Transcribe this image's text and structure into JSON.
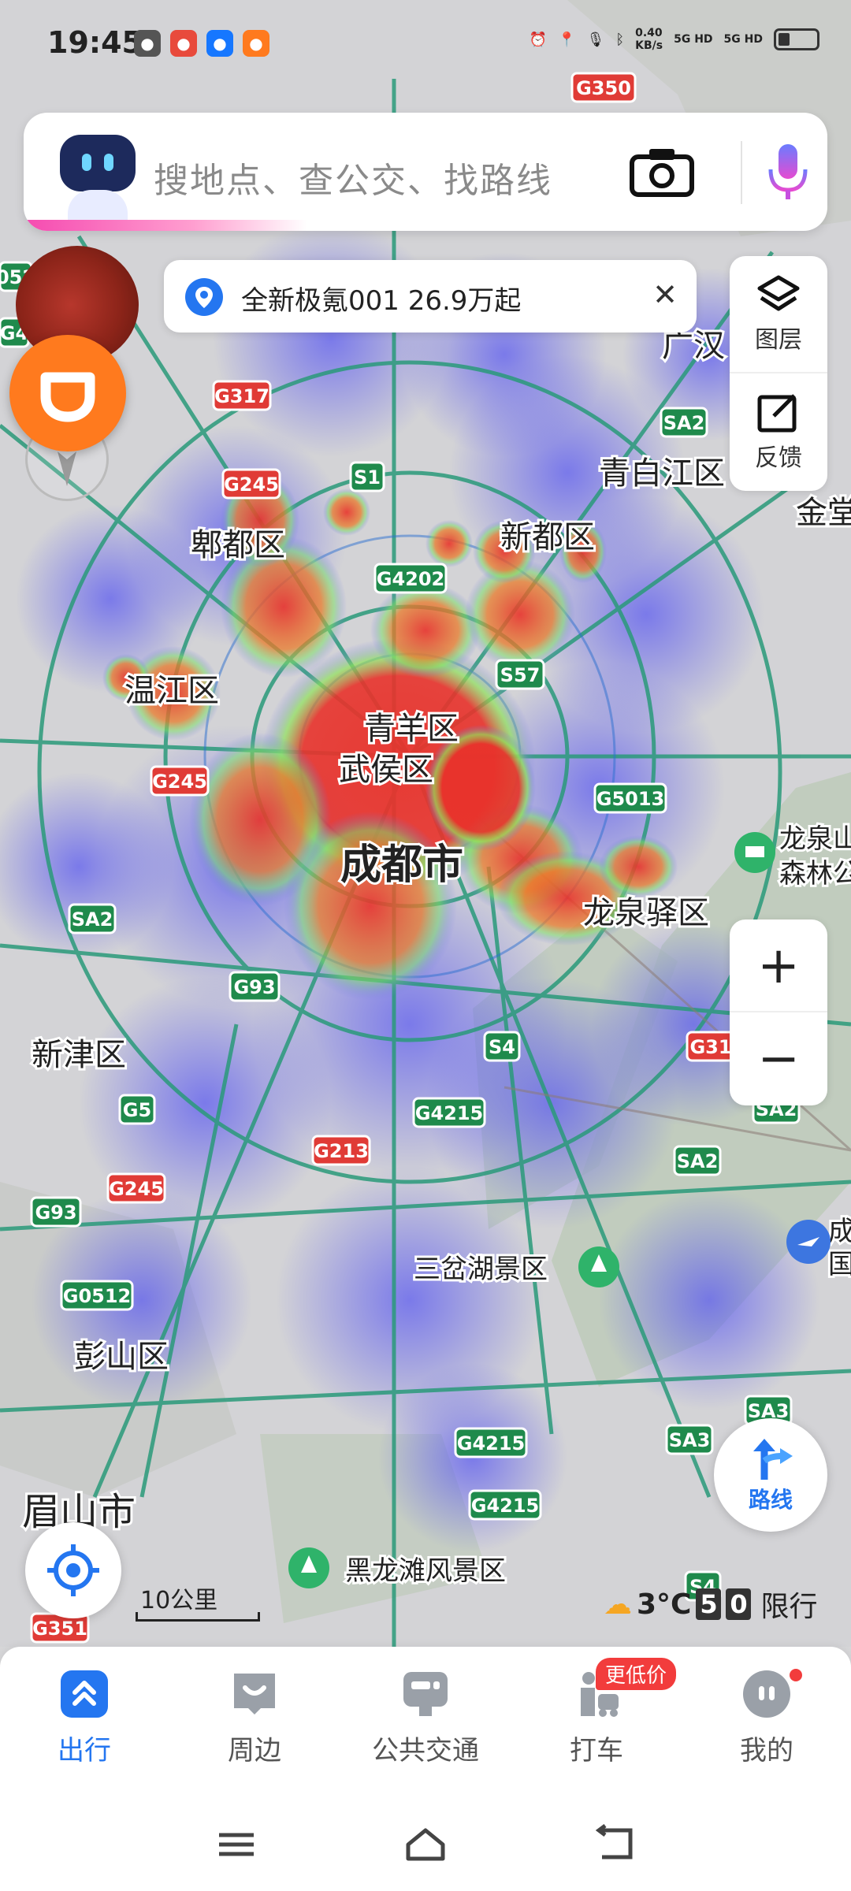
{
  "status_bar": {
    "time": "19:45",
    "net_speed_value": "0.40",
    "net_speed_unit": "KB/s",
    "signal_1": "5G HD",
    "signal_2": "5G HD"
  },
  "search": {
    "placeholder": "搜地点、查公交、找路线"
  },
  "ad_banner": {
    "text": "全新极氪001 26.9万起"
  },
  "side_panel": {
    "layers_label": "图层",
    "feedback_label": "反馈"
  },
  "map_labels": {
    "districts": [
      {
        "name": "郫都区"
      },
      {
        "name": "新都区"
      },
      {
        "name": "青白江区"
      },
      {
        "name": "温江区"
      },
      {
        "name": "青羊区"
      },
      {
        "name": "武侯区"
      },
      {
        "name": "成都市"
      },
      {
        "name": "龙泉驿区"
      },
      {
        "name": "新津区"
      },
      {
        "name": "彭山区"
      },
      {
        "name": "眉山市"
      },
      {
        "name": "广汉"
      },
      {
        "name": "金堂"
      },
      {
        "name": "三岔湖景区"
      },
      {
        "name": "黑龙滩风景区"
      },
      {
        "name": "龙泉山"
      },
      {
        "name": "森林公"
      },
      {
        "name": "成"
      },
      {
        "name": "国"
      }
    ],
    "roads": [
      {
        "name": "G350"
      },
      {
        "name": "G317"
      },
      {
        "name": "G245"
      },
      {
        "name": "S1"
      },
      {
        "name": "G4202"
      },
      {
        "name": "S57"
      },
      {
        "name": "G245"
      },
      {
        "name": "G5013"
      },
      {
        "name": "SA2"
      },
      {
        "name": "SA2"
      },
      {
        "name": "G93"
      },
      {
        "name": "S4"
      },
      {
        "name": "G5"
      },
      {
        "name": "G4215"
      },
      {
        "name": "G213"
      },
      {
        "name": "G245"
      },
      {
        "name": "G93"
      },
      {
        "name": "G0512"
      },
      {
        "name": "SA2"
      },
      {
        "name": "SA2"
      },
      {
        "name": "G4215"
      },
      {
        "name": "G4215"
      },
      {
        "name": "SA3"
      },
      {
        "name": "SA3"
      },
      {
        "name": "S4"
      },
      {
        "name": "G351"
      },
      {
        "name": "G31"
      },
      {
        "name": "052"
      },
      {
        "name": "G4"
      }
    ]
  },
  "zoom": {
    "in_label": "+",
    "out_label": "−"
  },
  "route_button": {
    "label": "路线"
  },
  "scale": {
    "label": "10公里"
  },
  "weather": {
    "temperature": "3°C",
    "restriction_digits": [
      "5",
      "0"
    ],
    "restriction_label": "限行"
  },
  "bottom_nav": {
    "items": [
      {
        "label": "出行",
        "icon": "travel-icon",
        "active": true
      },
      {
        "label": "周边",
        "icon": "nearby-icon",
        "active": false
      },
      {
        "label": "公共交通",
        "icon": "bus-icon",
        "active": false
      },
      {
        "label": "打车",
        "icon": "taxi-icon",
        "active": false
      },
      {
        "label": "我的",
        "icon": "profile-icon",
        "active": false
      }
    ],
    "promo_badge": "更低价"
  },
  "colors": {
    "accent": "#2476f0",
    "heat_high": "#e8322b",
    "heat_low": "#6f6cf2",
    "road": "#2a9a7a",
    "highway_label": "#e03b36",
    "provincial_label": "#1f8a4c",
    "didi": "#ff7a1e"
  }
}
